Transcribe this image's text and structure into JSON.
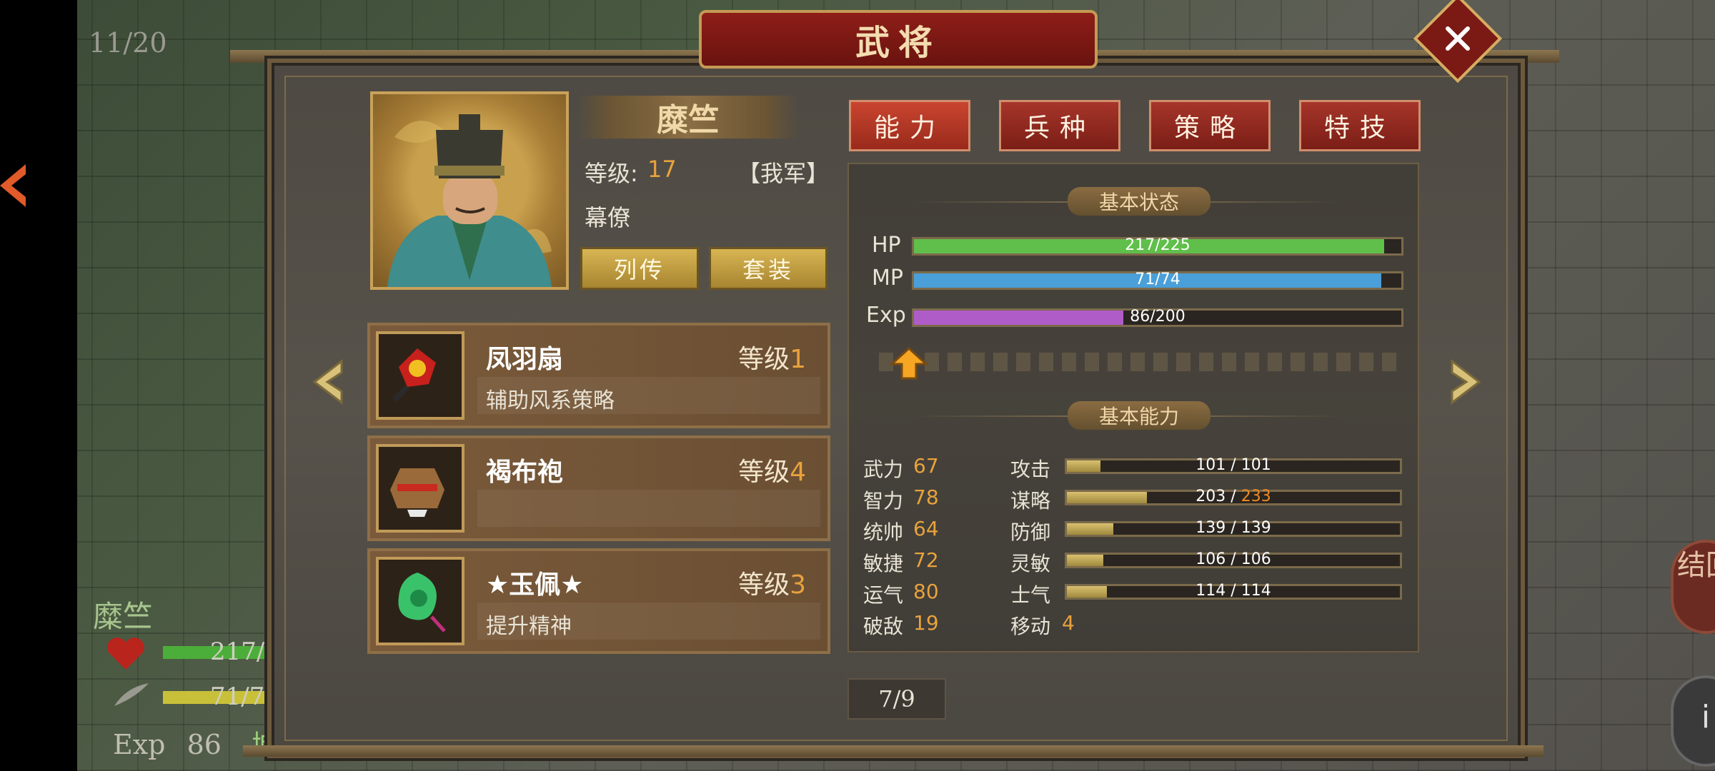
{
  "background": {
    "counter": "11/20",
    "unit_name": "糜竺",
    "hp_text": "217/",
    "mp_text": "71/7",
    "exp_label": "Exp",
    "exp_value": "86",
    "exp_suffix": "城",
    "right_button_1": "结回",
    "right_button_2": "i"
  },
  "window": {
    "title": "武将",
    "close_icon": "close-icon"
  },
  "general": {
    "name": "糜竺",
    "level_label": "等级:",
    "level_value": "17",
    "faction": "【我军】",
    "role": "幕僚",
    "buttons": [
      "列传",
      "套装"
    ]
  },
  "items": [
    {
      "name": "凤羽扇",
      "level_label": "等级",
      "level": "1",
      "desc": "辅助风系策略",
      "icon": "feather-fan-icon"
    },
    {
      "name": "褐布袍",
      "level_label": "等级",
      "level": "4",
      "desc": "",
      "icon": "robe-icon"
    },
    {
      "name": "★玉佩★",
      "level_label": "等级",
      "level": "3",
      "desc": "提升精神",
      "icon": "jade-pendant-icon"
    }
  ],
  "tabs": [
    "能力",
    "兵种",
    "策略",
    "特技"
  ],
  "active_tab": 0,
  "status_section": "基本状态",
  "bars": [
    {
      "label": "HP",
      "text": "217/225",
      "value": 217,
      "max": 225,
      "color": "#5fbf4a"
    },
    {
      "label": "MP",
      "text": "71/74",
      "value": 71,
      "max": 74,
      "color": "#4a9fd8"
    },
    {
      "label": "Exp",
      "text": "86/200",
      "value": 86,
      "max": 200,
      "color": "#b05cc8"
    }
  ],
  "ability_section": "基本能力",
  "attributes": [
    {
      "label": "武力",
      "value": "67"
    },
    {
      "label": "智力",
      "value": "78"
    },
    {
      "label": "统帅",
      "value": "64"
    },
    {
      "label": "敏捷",
      "value": "72"
    },
    {
      "label": "运气",
      "value": "80"
    },
    {
      "label": "破敌",
      "value": "19"
    }
  ],
  "combat_stats": [
    {
      "label": "攻击",
      "current": "101",
      "max": "101",
      "fill": 0.1
    },
    {
      "label": "谋略",
      "current": "203",
      "max": "233",
      "fill": 0.24,
      "highlight": true
    },
    {
      "label": "防御",
      "current": "139",
      "max": "139",
      "fill": 0.14
    },
    {
      "label": "灵敏",
      "current": "106",
      "max": "106",
      "fill": 0.11
    },
    {
      "label": "士气",
      "current": "114",
      "max": "114",
      "fill": 0.12
    }
  ],
  "move": {
    "label": "移动",
    "value": "4"
  },
  "page": "7/9",
  "colors": {
    "accent": "#e8a23d",
    "tab_red": "#a6352a",
    "gold": "#c9a25a"
  }
}
